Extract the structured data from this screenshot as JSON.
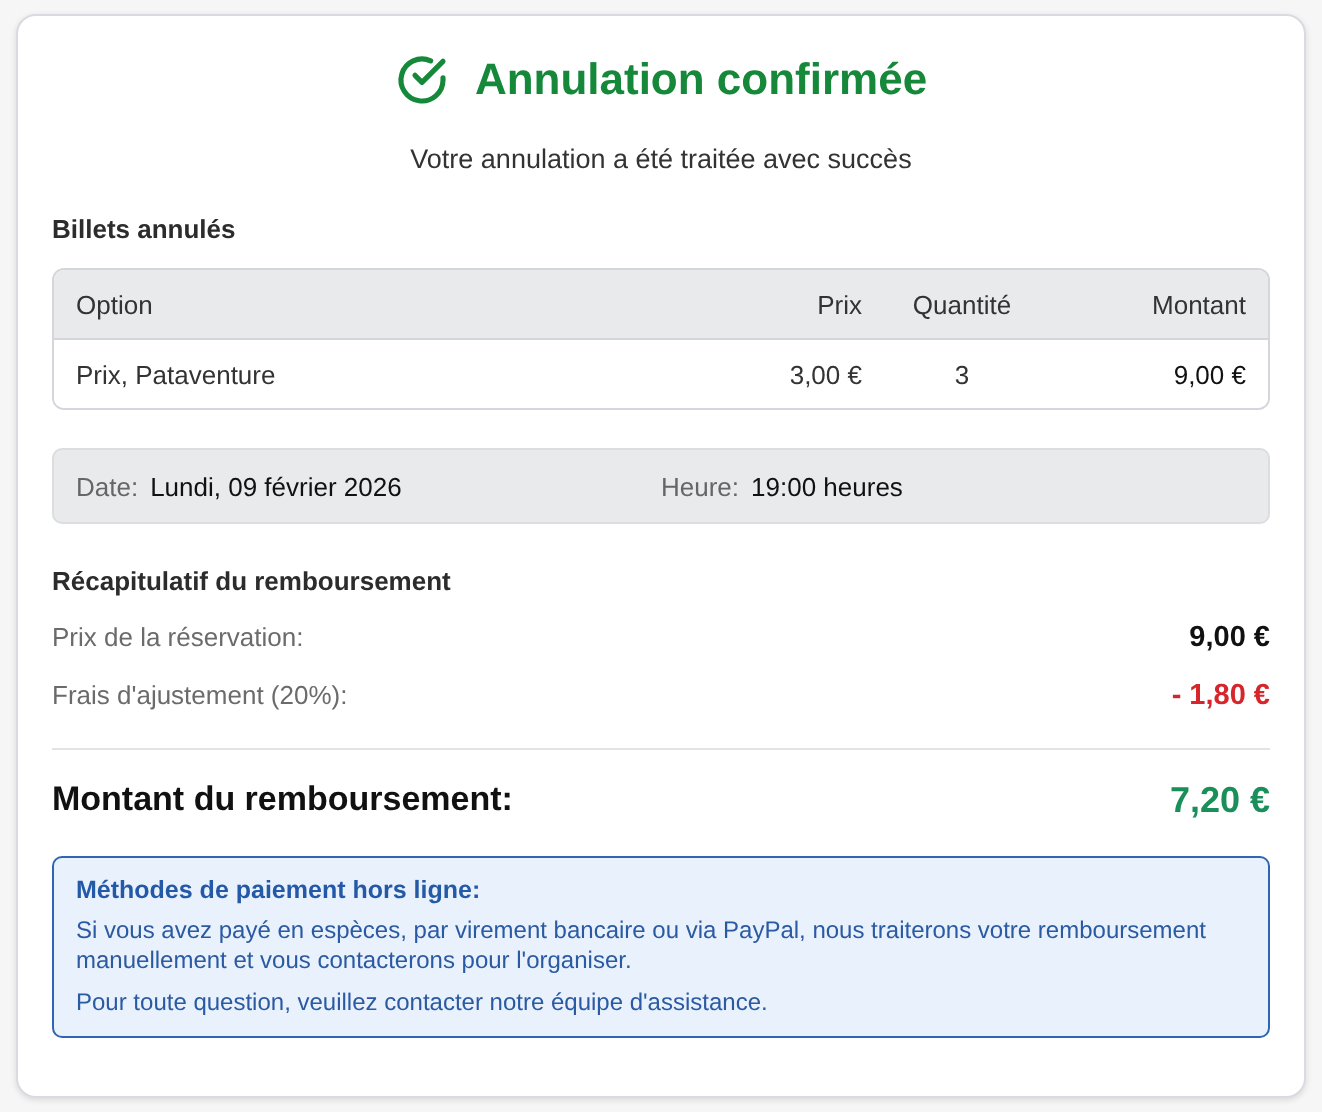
{
  "header": {
    "title": "Annulation confirmée",
    "subtitle": "Votre annulation a été traitée avec succès"
  },
  "tickets": {
    "heading": "Billets annulés",
    "columns": [
      "Option",
      "Prix",
      "Quantité",
      "Montant"
    ],
    "rows": [
      [
        "Prix, Pataventure",
        "3,00 €",
        "3",
        "9,00 €"
      ]
    ]
  },
  "details": [
    {
      "label": "Date:",
      "value": "Lundi, 09 février 2026"
    },
    {
      "label": "Heure:",
      "value": "19:00 heures"
    }
  ],
  "summary": {
    "heading": "Récapitulatif du remboursement",
    "lines": [
      {
        "label": "Prix de la réservation:",
        "value": "9,00 €",
        "kind": "charge"
      },
      {
        "label": "Frais d'ajustement (20%):",
        "value": "- 1,80 €",
        "kind": "deduction"
      }
    ],
    "total": {
      "label": "Montant du remboursement:",
      "value": "7,20 €"
    }
  },
  "notice": {
    "title": "Méthodes de paiement hors ligne:",
    "paragraphs": [
      "Si vous avez payé en espèces, par virement bancaire ou via PayPal, nous traiterons votre remboursement manuellement et vous contacterons pour l'organiser.",
      "Pour toute question, veuillez contacter notre équipe d'assistance."
    ]
  }
}
